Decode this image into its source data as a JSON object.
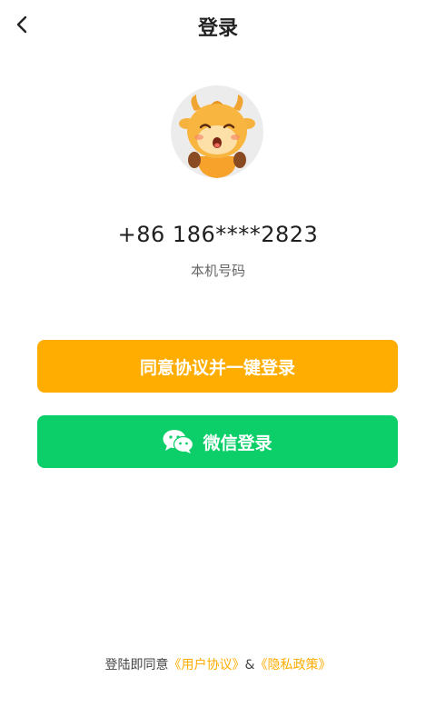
{
  "header": {
    "back_icon": "chevron-left-icon",
    "title": "登录"
  },
  "avatar": {
    "description_icon": "cartoon-ox-mascot"
  },
  "phone": {
    "number": "+86 186****2823",
    "caption": "本机号码"
  },
  "buttons": {
    "one_key_login": "同意协议并一键登录",
    "wechat_login": "微信登录",
    "wechat_icon": "wechat-icon"
  },
  "footer": {
    "prefix": "登陆即同意",
    "user_agreement": "《用户协议》",
    "separator": "&",
    "privacy_policy": "《隐私政策》"
  },
  "colors": {
    "primary_orange": "#ffad00",
    "wechat_green": "#0dcf69"
  }
}
